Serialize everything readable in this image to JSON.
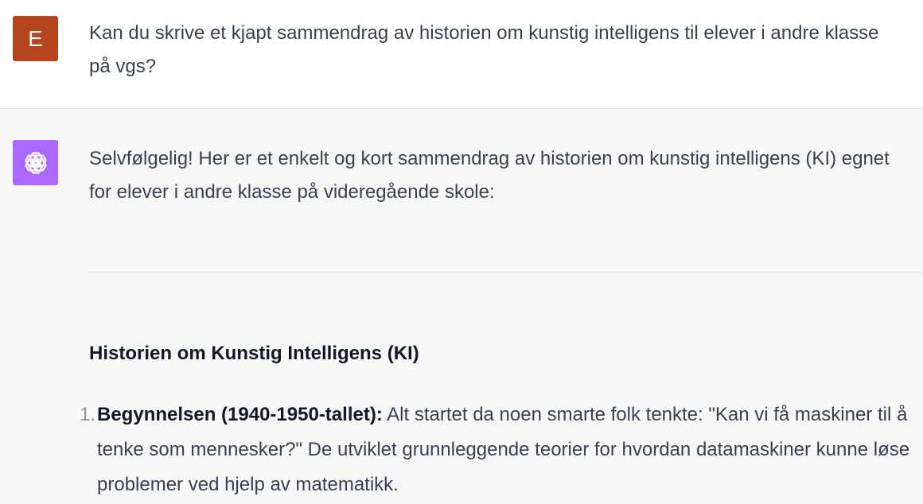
{
  "user_message": {
    "avatar_letter": "E",
    "text": "Kan du skrive et kjapt sammendrag av historien om kunstig intelligens til elever i andre klasse på vgs?"
  },
  "assistant_message": {
    "avatar_icon": "openai-logo-icon",
    "intro": "Selvfølgelig! Her er et enkelt og kort sammendrag av historien om kunstig intelligens (KI) egnet for elever i andre klasse på videregående skole:",
    "heading": "Historien om Kunstig Intelligens (KI)",
    "list": [
      {
        "number": "1.",
        "title": "Begynnelsen (1940-1950-tallet):",
        "text": " Alt startet da noen smarte folk tenkte: \"Kan vi få maskiner til å tenke som mennesker?\" De utviklet grunnleggende teorier for hvordan datamaskiner kunne løse problemer ved hjelp av matematikk."
      }
    ]
  },
  "colors": {
    "user_avatar_bg": "#b6441f",
    "assistant_avatar_bg": "#ab68ff",
    "assistant_row_bg": "#f7f7f8"
  }
}
